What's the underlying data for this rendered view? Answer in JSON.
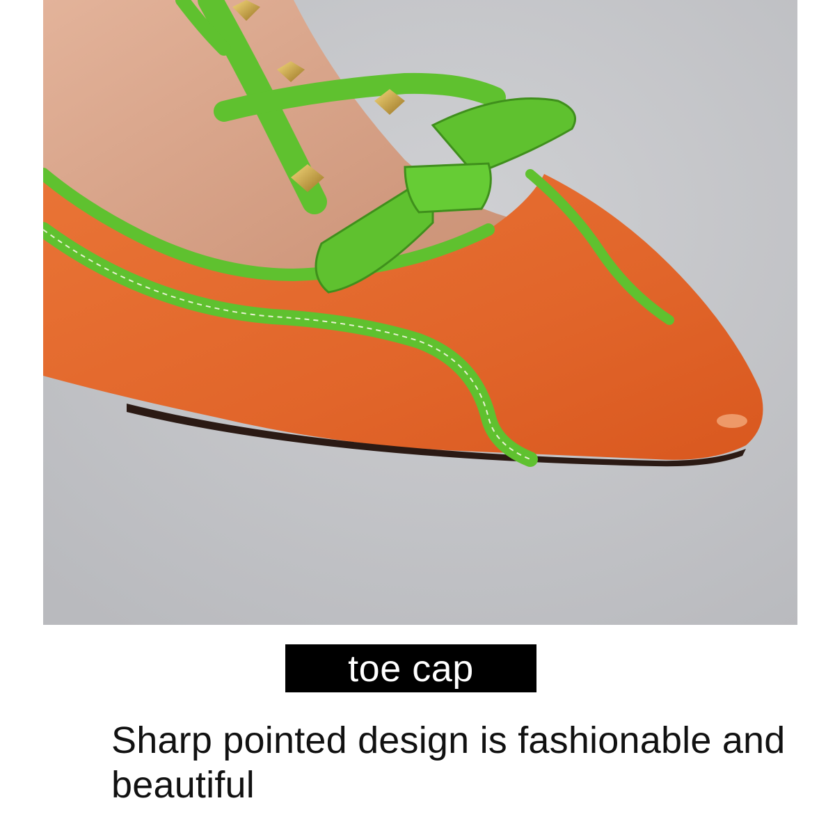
{
  "product_photo": {
    "subject": "orange pointed-toe pump with green trim, green bow and gold studs",
    "colors": {
      "background": "#c9c9cc",
      "leather_orange": "#e56a2a",
      "trim_green": "#5fc12f",
      "stud_gold": "#c9a23c",
      "lining": "#d9a689"
    }
  },
  "label": {
    "text": "toe cap",
    "background": "#000000",
    "color": "#ffffff"
  },
  "caption": {
    "text": "Sharp pointed design is fashionable and beautiful"
  }
}
